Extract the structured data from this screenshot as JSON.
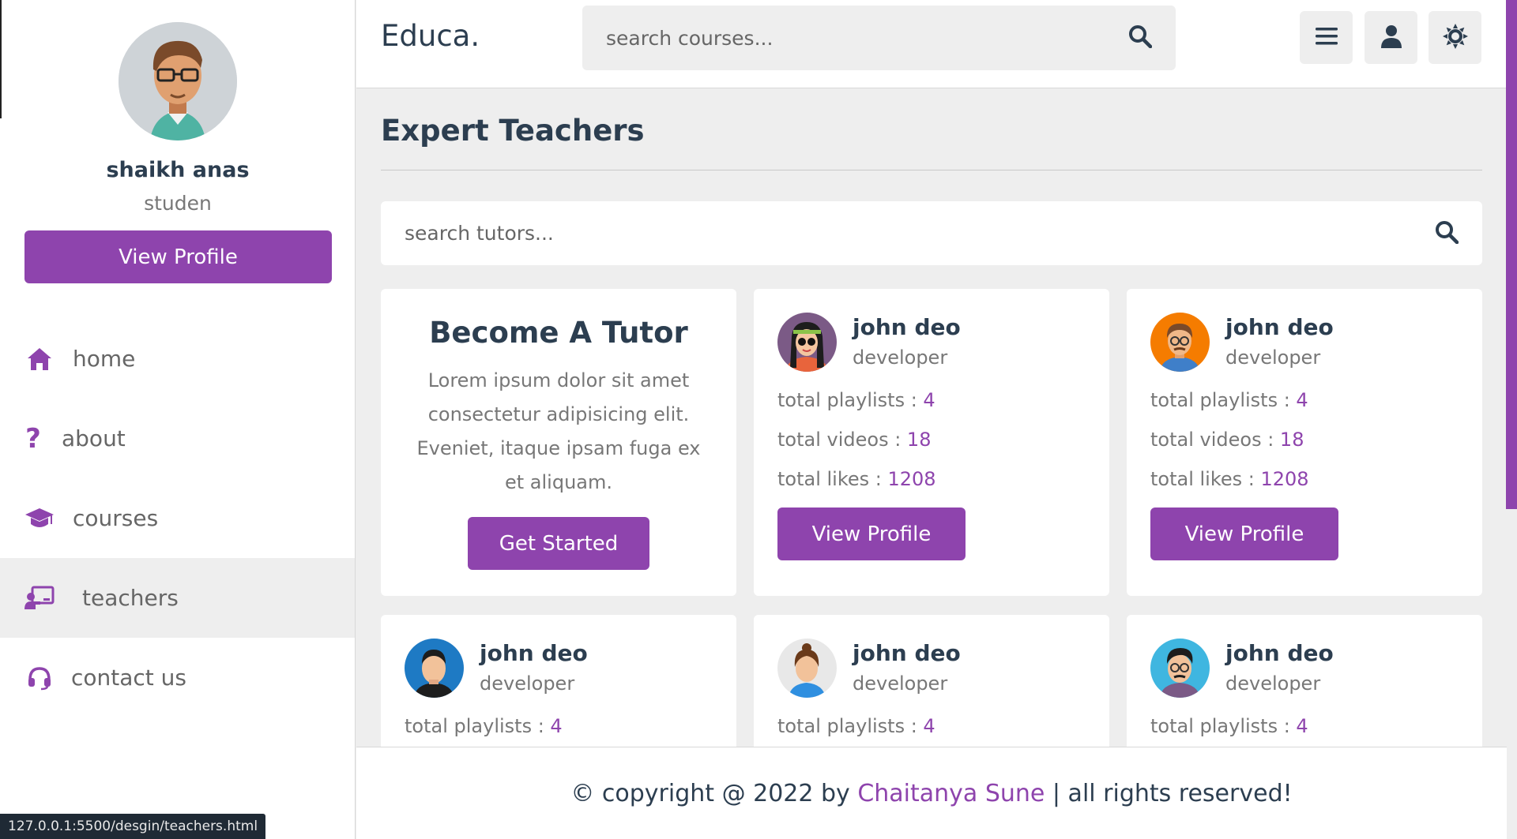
{
  "app": {
    "logo": "Educa."
  },
  "header": {
    "search_placeholder": "search courses...",
    "menu_icon": "bars-icon",
    "user_icon": "user-icon",
    "theme_icon": "sun-icon"
  },
  "profile": {
    "name": "shaikh anas",
    "role": "studen",
    "button": "View Profile"
  },
  "nav": [
    {
      "label": "home",
      "icon": "home-icon"
    },
    {
      "label": "about",
      "icon": "question-icon"
    },
    {
      "label": "courses",
      "icon": "graduation-cap-icon"
    },
    {
      "label": "teachers",
      "icon": "chalkboard-teacher-icon",
      "active": true
    },
    {
      "label": "contact us",
      "icon": "headset-icon"
    }
  ],
  "main": {
    "title": "Expert Teachers",
    "search_placeholder": "search tutors..."
  },
  "tutor_card": {
    "title": "Become A Tutor",
    "text": "Lorem ipsum dolor sit amet consectetur adipisicing elit. Eveniet, itaque ipsam fuga ex et aliquam.",
    "button": "Get Started"
  },
  "stat_labels": {
    "playlists": "total playlists : ",
    "videos": "total videos : ",
    "likes": "total likes : "
  },
  "teachers": [
    {
      "name": "john deo",
      "role": "developer",
      "playlists": "4",
      "videos": "18",
      "likes": "1208",
      "button": "View Profile"
    },
    {
      "name": "john deo",
      "role": "developer",
      "playlists": "4",
      "videos": "18",
      "likes": "1208",
      "button": "View Profile"
    },
    {
      "name": "john deo",
      "role": "developer",
      "playlists": "4"
    },
    {
      "name": "john deo",
      "role": "developer",
      "playlists": "4"
    },
    {
      "name": "john deo",
      "role": "developer",
      "playlists": "4"
    }
  ],
  "footer": {
    "prefix": "© copyright @ 2022 by ",
    "author": "Chaitanya Sune",
    "suffix": " | all rights reserved!"
  },
  "status_bar": {
    "url": "127.0.0.1:5500/desgin/teachers.html"
  },
  "colors": {
    "accent": "#8e44ad",
    "text": "#2c3e50",
    "muted": "#777777",
    "background": "#eeeeee"
  }
}
